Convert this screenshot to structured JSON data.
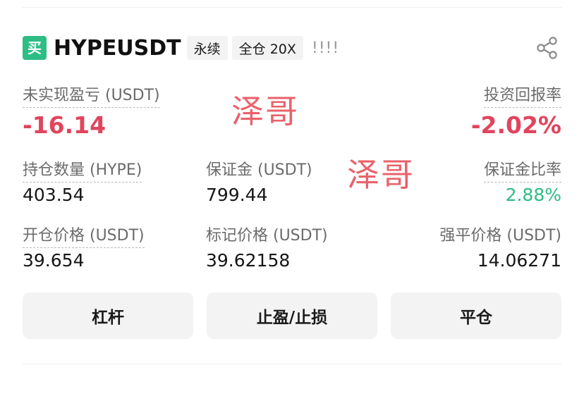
{
  "header": {
    "side_badge": "买",
    "symbol": "HYPEUSDT",
    "tag_type": "永续",
    "tag_margin": "全仓 20X",
    "bars": "!!!!",
    "share_icon": "share-icon"
  },
  "watermarks": [
    "泽哥",
    "泽哥"
  ],
  "pnl": {
    "unrealized_label": "未实现盈亏 (USDT)",
    "unrealized_value": "-16.14",
    "roi_label": "投资回报率",
    "roi_value": "-2.02%"
  },
  "row1": {
    "qty_label": "持仓数量 (HYPE)",
    "qty_value": "403.54",
    "margin_label": "保证金 (USDT)",
    "margin_value": "799.44",
    "margin_ratio_label": "保证金比率",
    "margin_ratio_value": "2.88%"
  },
  "row2": {
    "entry_label": "开仓价格 (USDT)",
    "entry_value": "39.654",
    "mark_label": "标记价格 (USDT)",
    "mark_value": "39.62158",
    "liq_label": "强平价格 (USDT)",
    "liq_value": "14.06271"
  },
  "buttons": {
    "leverage": "杠杆",
    "tpsl": "止盈/止损",
    "close": "平仓"
  },
  "colors": {
    "buy_green": "#2ebd85",
    "loss_red": "#e0455d",
    "watermark_red": "#e9555f",
    "button_bg": "#f3f3f3"
  }
}
